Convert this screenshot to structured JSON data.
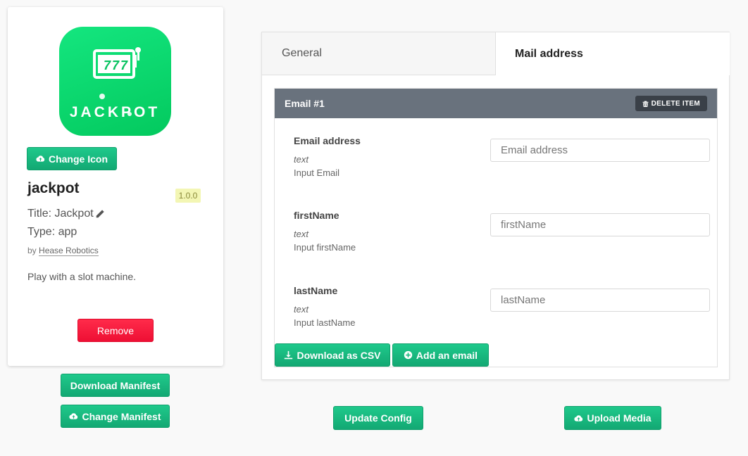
{
  "app": {
    "icon_text": "JACKPOT",
    "change_icon_label": "Change Icon",
    "name": "jackpot",
    "version": "1.0.0",
    "title_line": "Title: Jackpot",
    "type_line": "Type: app",
    "by_prefix": "by",
    "author": "Hease Robotics",
    "description": "Play with a slot machine.",
    "remove_label": "Remove"
  },
  "manifest": {
    "download_label": "Download Manifest",
    "change_label": "Change Manifest"
  },
  "tabs": [
    {
      "label": "General",
      "active": false
    },
    {
      "label": "Mail address",
      "active": true
    }
  ],
  "email_item": {
    "header": "Email #1",
    "delete_label": "DELETE ITEM",
    "fields": [
      {
        "label": "Email address",
        "type": "text",
        "description": "Input Email",
        "placeholder": "Email address",
        "value": ""
      },
      {
        "label": "firstName",
        "type": "text",
        "description": "Input firstName",
        "placeholder": "firstName",
        "value": ""
      },
      {
        "label": "lastName",
        "type": "text",
        "description": "Input lastName",
        "placeholder": "lastName",
        "value": ""
      }
    ]
  },
  "actions": {
    "download_csv_label": "Download as CSV",
    "add_email_label": "Add an email",
    "update_config_label": "Update Config",
    "upload_media_label": "Upload Media"
  },
  "colors": {
    "accent_green": "#17b87e",
    "danger_red": "#f0133a",
    "header_gray": "#69727d",
    "icon_green": "#06d068"
  }
}
